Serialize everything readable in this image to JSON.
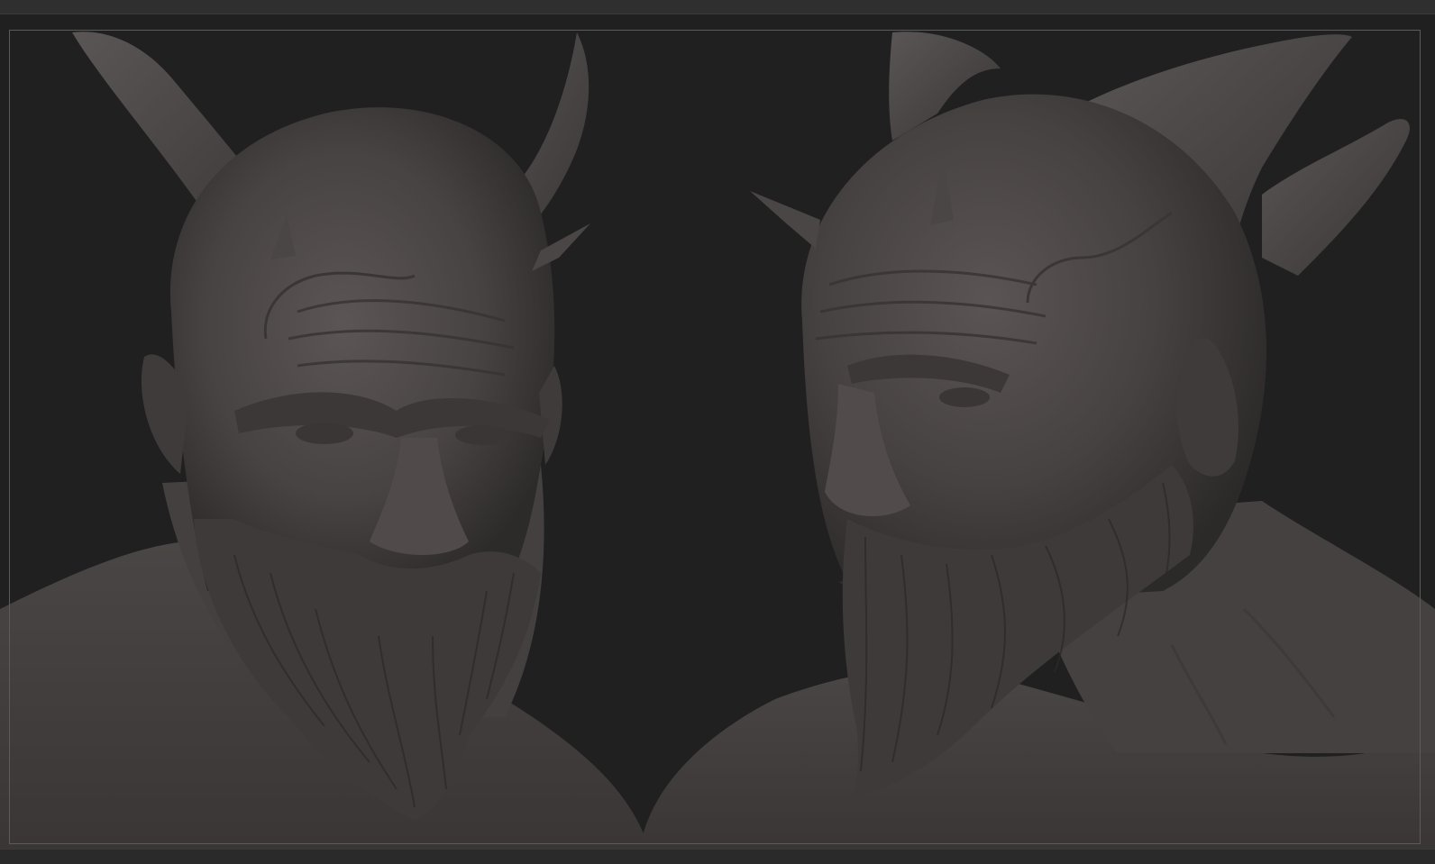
{
  "app": {
    "name": "",
    "view": "sculpt-viewport"
  },
  "canvas": {
    "background_color": "#202021",
    "frame_border_color": "#5b5b5c",
    "material_color": "#4e4a49"
  },
  "subjects": [
    {
      "name": "demon-bust-front-view"
    },
    {
      "name": "demon-bust-three-quarter-view"
    }
  ]
}
